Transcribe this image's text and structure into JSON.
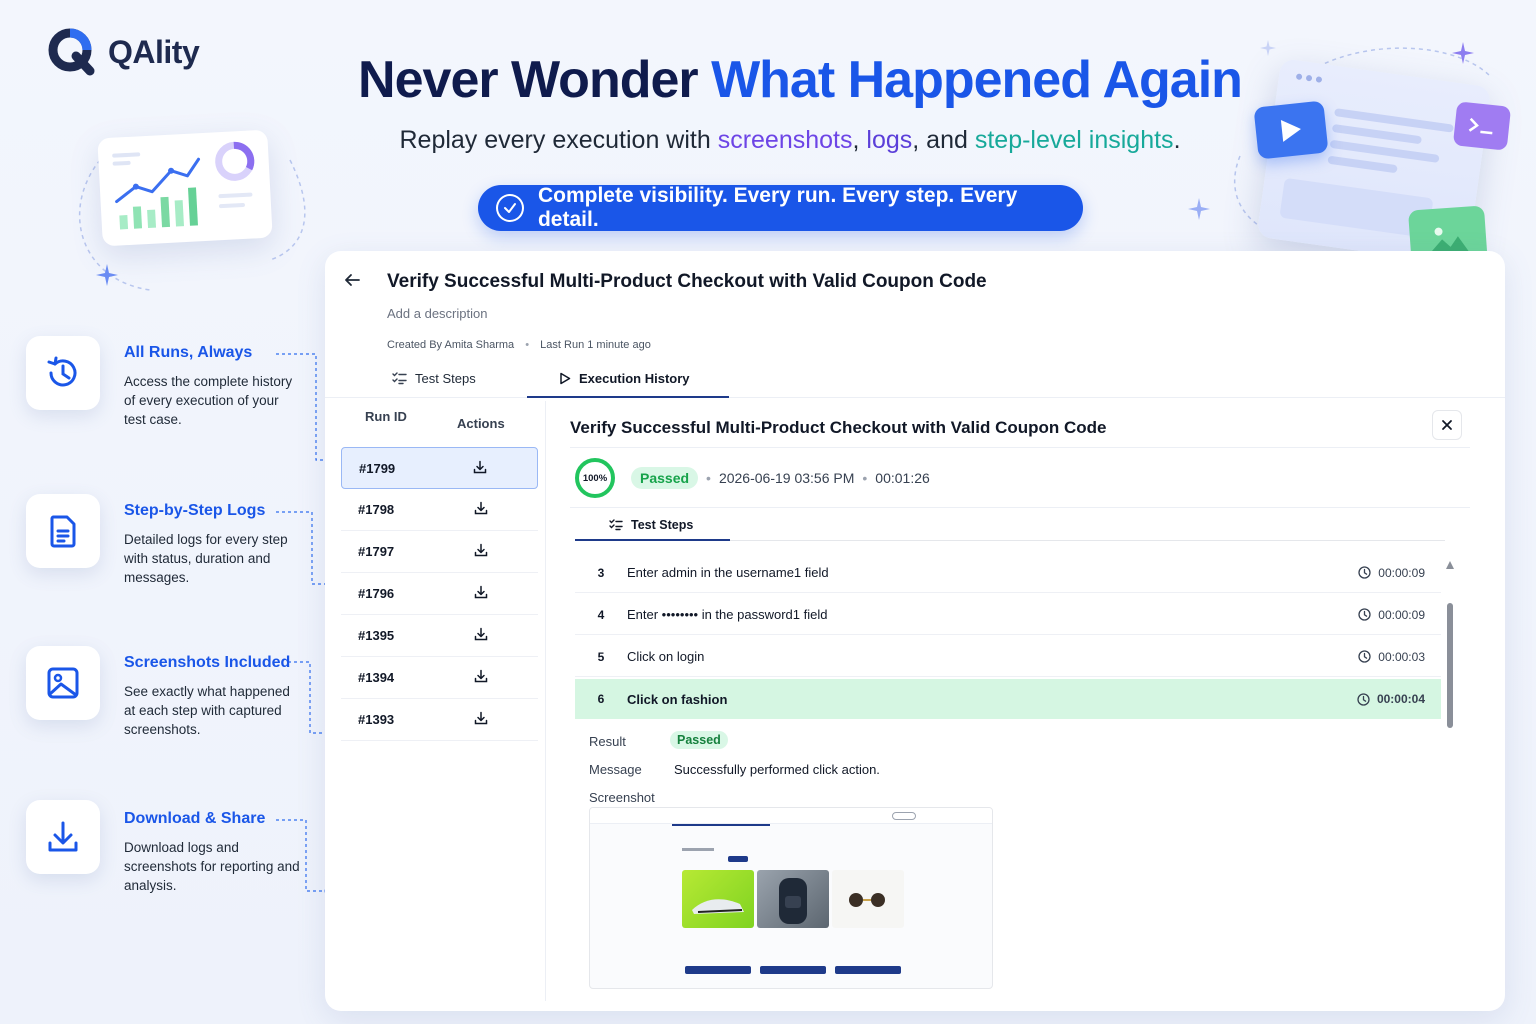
{
  "brand": {
    "name": "QAlity"
  },
  "hero": {
    "title_part1": "Never Wonder ",
    "title_part2": "What Happened Again",
    "sub_prefix": "Replay every execution with ",
    "sub_screenshots": "screenshots",
    "sub_comma": ", ",
    "sub_logs": "logs",
    "sub_and": ", and ",
    "sub_insights": "step-level insights",
    "sub_period": ".",
    "pill": "Complete visibility. Every run. Every step. Every detail."
  },
  "features": [
    {
      "title": "All Runs, Always",
      "desc": "Access the complete history of every execution of your test case.",
      "icon": "history-icon"
    },
    {
      "title": "Step-by-Step Logs",
      "desc": "Detailed logs for every step with status, duration and messages.",
      "icon": "document-icon"
    },
    {
      "title": "Screenshots Included",
      "desc": "See exactly what happened at each step with captured screenshots.",
      "icon": "image-icon"
    },
    {
      "title": "Download & Share",
      "desc": "Download logs and screenshots for reporting and analysis.",
      "icon": "download-icon"
    }
  ],
  "testcase": {
    "title": "Verify Successful Multi-Product Checkout with Valid Coupon Code",
    "description_placeholder": "Add a description",
    "created_by": "Created By Amita Sharma",
    "meta_dot": "•",
    "last_run": "Last Run 1 minute ago"
  },
  "tabs": {
    "test_steps": "Test Steps",
    "execution_history": "Execution History"
  },
  "runs": {
    "col_run_id": "Run ID",
    "col_actions": "Actions",
    "rows": [
      "#1799",
      "#1798",
      "#1797",
      "#1796",
      "#1395",
      "#1394",
      "#1393"
    ]
  },
  "execution": {
    "title": "Verify Successful Multi-Product Checkout with Valid Coupon Code",
    "progress": "100%",
    "status": "Passed",
    "sep": "•",
    "date": "2026-06-19 03:56 PM",
    "duration": "00:01:26",
    "subtab": "Test Steps",
    "steps": [
      {
        "num": "3",
        "text": "Enter admin in the username1 field",
        "dur": "00:00:09"
      },
      {
        "num": "4",
        "text": "Enter •••••••• in the password1 field",
        "dur": "00:00:09"
      },
      {
        "num": "5",
        "text": "Click on login",
        "dur": "00:00:03"
      },
      {
        "num": "6",
        "text": "Click on fashion",
        "dur": "00:00:04"
      }
    ],
    "result_label": "Result",
    "result_value": "Passed",
    "message_label": "Message",
    "message_value": "Successfully performed click action.",
    "screenshot_label": "Screenshot"
  },
  "colors": {
    "accent": "#1a56e8",
    "navy": "#0f1b4d",
    "success": "#22c55e",
    "highlight_row": "#d5f6e2"
  }
}
